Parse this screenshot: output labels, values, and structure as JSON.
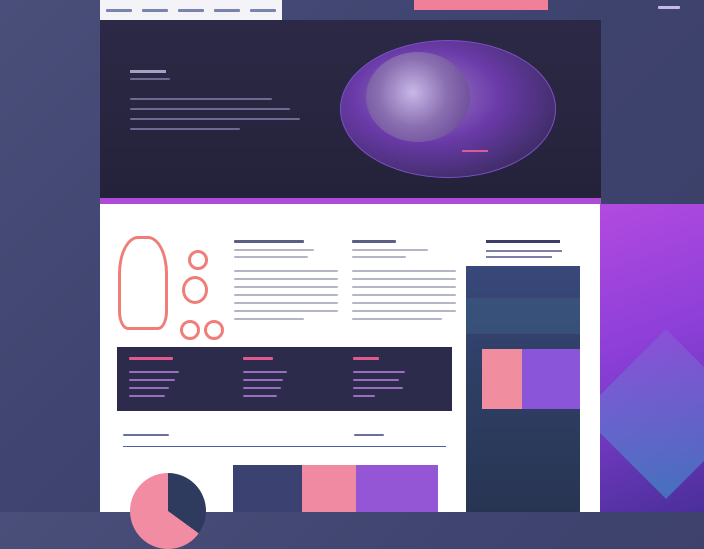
{
  "top_nav": {
    "item_count": 5,
    "accent_color": "#f0809a"
  },
  "hero": {
    "background_color": "#24223a",
    "visual": "abstract-globe-illustration",
    "line_count": 5
  },
  "panel": {
    "background_color": "#ffffff",
    "left_columns": 2,
    "right_sidebar_colors": [
      "#f08ea0",
      "#8a55d8"
    ]
  },
  "stats_band": {
    "column_count": 3,
    "background_color": "#2c2b4c",
    "heading_color": "#e05a8e"
  },
  "bottom": {
    "pie_colors": [
      "#2f3b5e",
      "#f28ca2"
    ],
    "card_colors": [
      "#3b4272",
      "#f08aa2",
      "#9556d6"
    ]
  },
  "colors": {
    "page_background": "#3f4470",
    "brand_purple": "#b04ad8",
    "accent_coral": "#f07d77"
  }
}
